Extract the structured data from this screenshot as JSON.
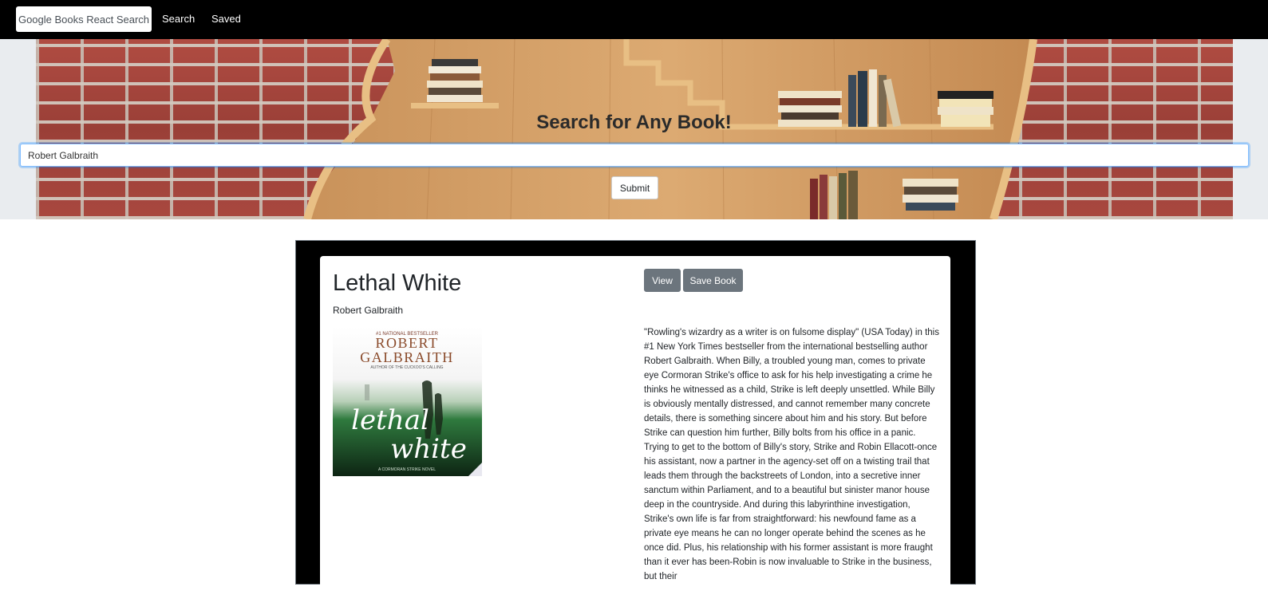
{
  "navbar": {
    "brand": "Google Books React Search",
    "links": [
      "Search",
      "Saved"
    ]
  },
  "jumbotron": {
    "heading": "Search for Any Book!",
    "search_value": "Robert Galbraith",
    "submit_label": "Submit"
  },
  "results": [
    {
      "title": "Lethal White",
      "author": "Robert Galbraith",
      "cover": {
        "top_text": "#1 NATIONAL BESTSELLER",
        "author_line1": "ROBERT",
        "author_line2": "GALBRAITH",
        "byline": "AUTHOR OF THE CUCKOO'S CALLING",
        "title_line1": "lethal",
        "title_line2": "white",
        "series": "A CORMORAN STRIKE NOVEL"
      },
      "view_label": "View",
      "save_label": "Save Book",
      "description": "\"Rowling's wizardry as a writer is on fulsome display\" (USA Today) in this #1 New York Times bestseller from the international bestselling author Robert Galbraith. When Billy, a troubled young man, comes to private eye Cormoran Strike's office to ask for his help investigating a crime he thinks he witnessed as a child, Strike is left deeply unsettled. While Billy is obviously mentally distressed, and cannot remember many concrete details, there is something sincere about him and his story. But before Strike can question him further, Billy bolts from his office in a panic. Trying to get to the bottom of Billy's story, Strike and Robin Ellacott-once his assistant, now a partner in the agency-set off on a twisting trail that leads them through the backstreets of London, into a secretive inner sanctum within Parliament, and to a beautiful but sinister manor house deep in the countryside. And during this labyrinthine investigation, Strike's own life is far from straightforward: his newfound fame as a private eye means he can no longer operate behind the scenes as he once did. Plus, his relationship with his former assistant is more fraught than it ever has been-Robin is now invaluable to Strike in the business, but their"
    }
  ]
}
